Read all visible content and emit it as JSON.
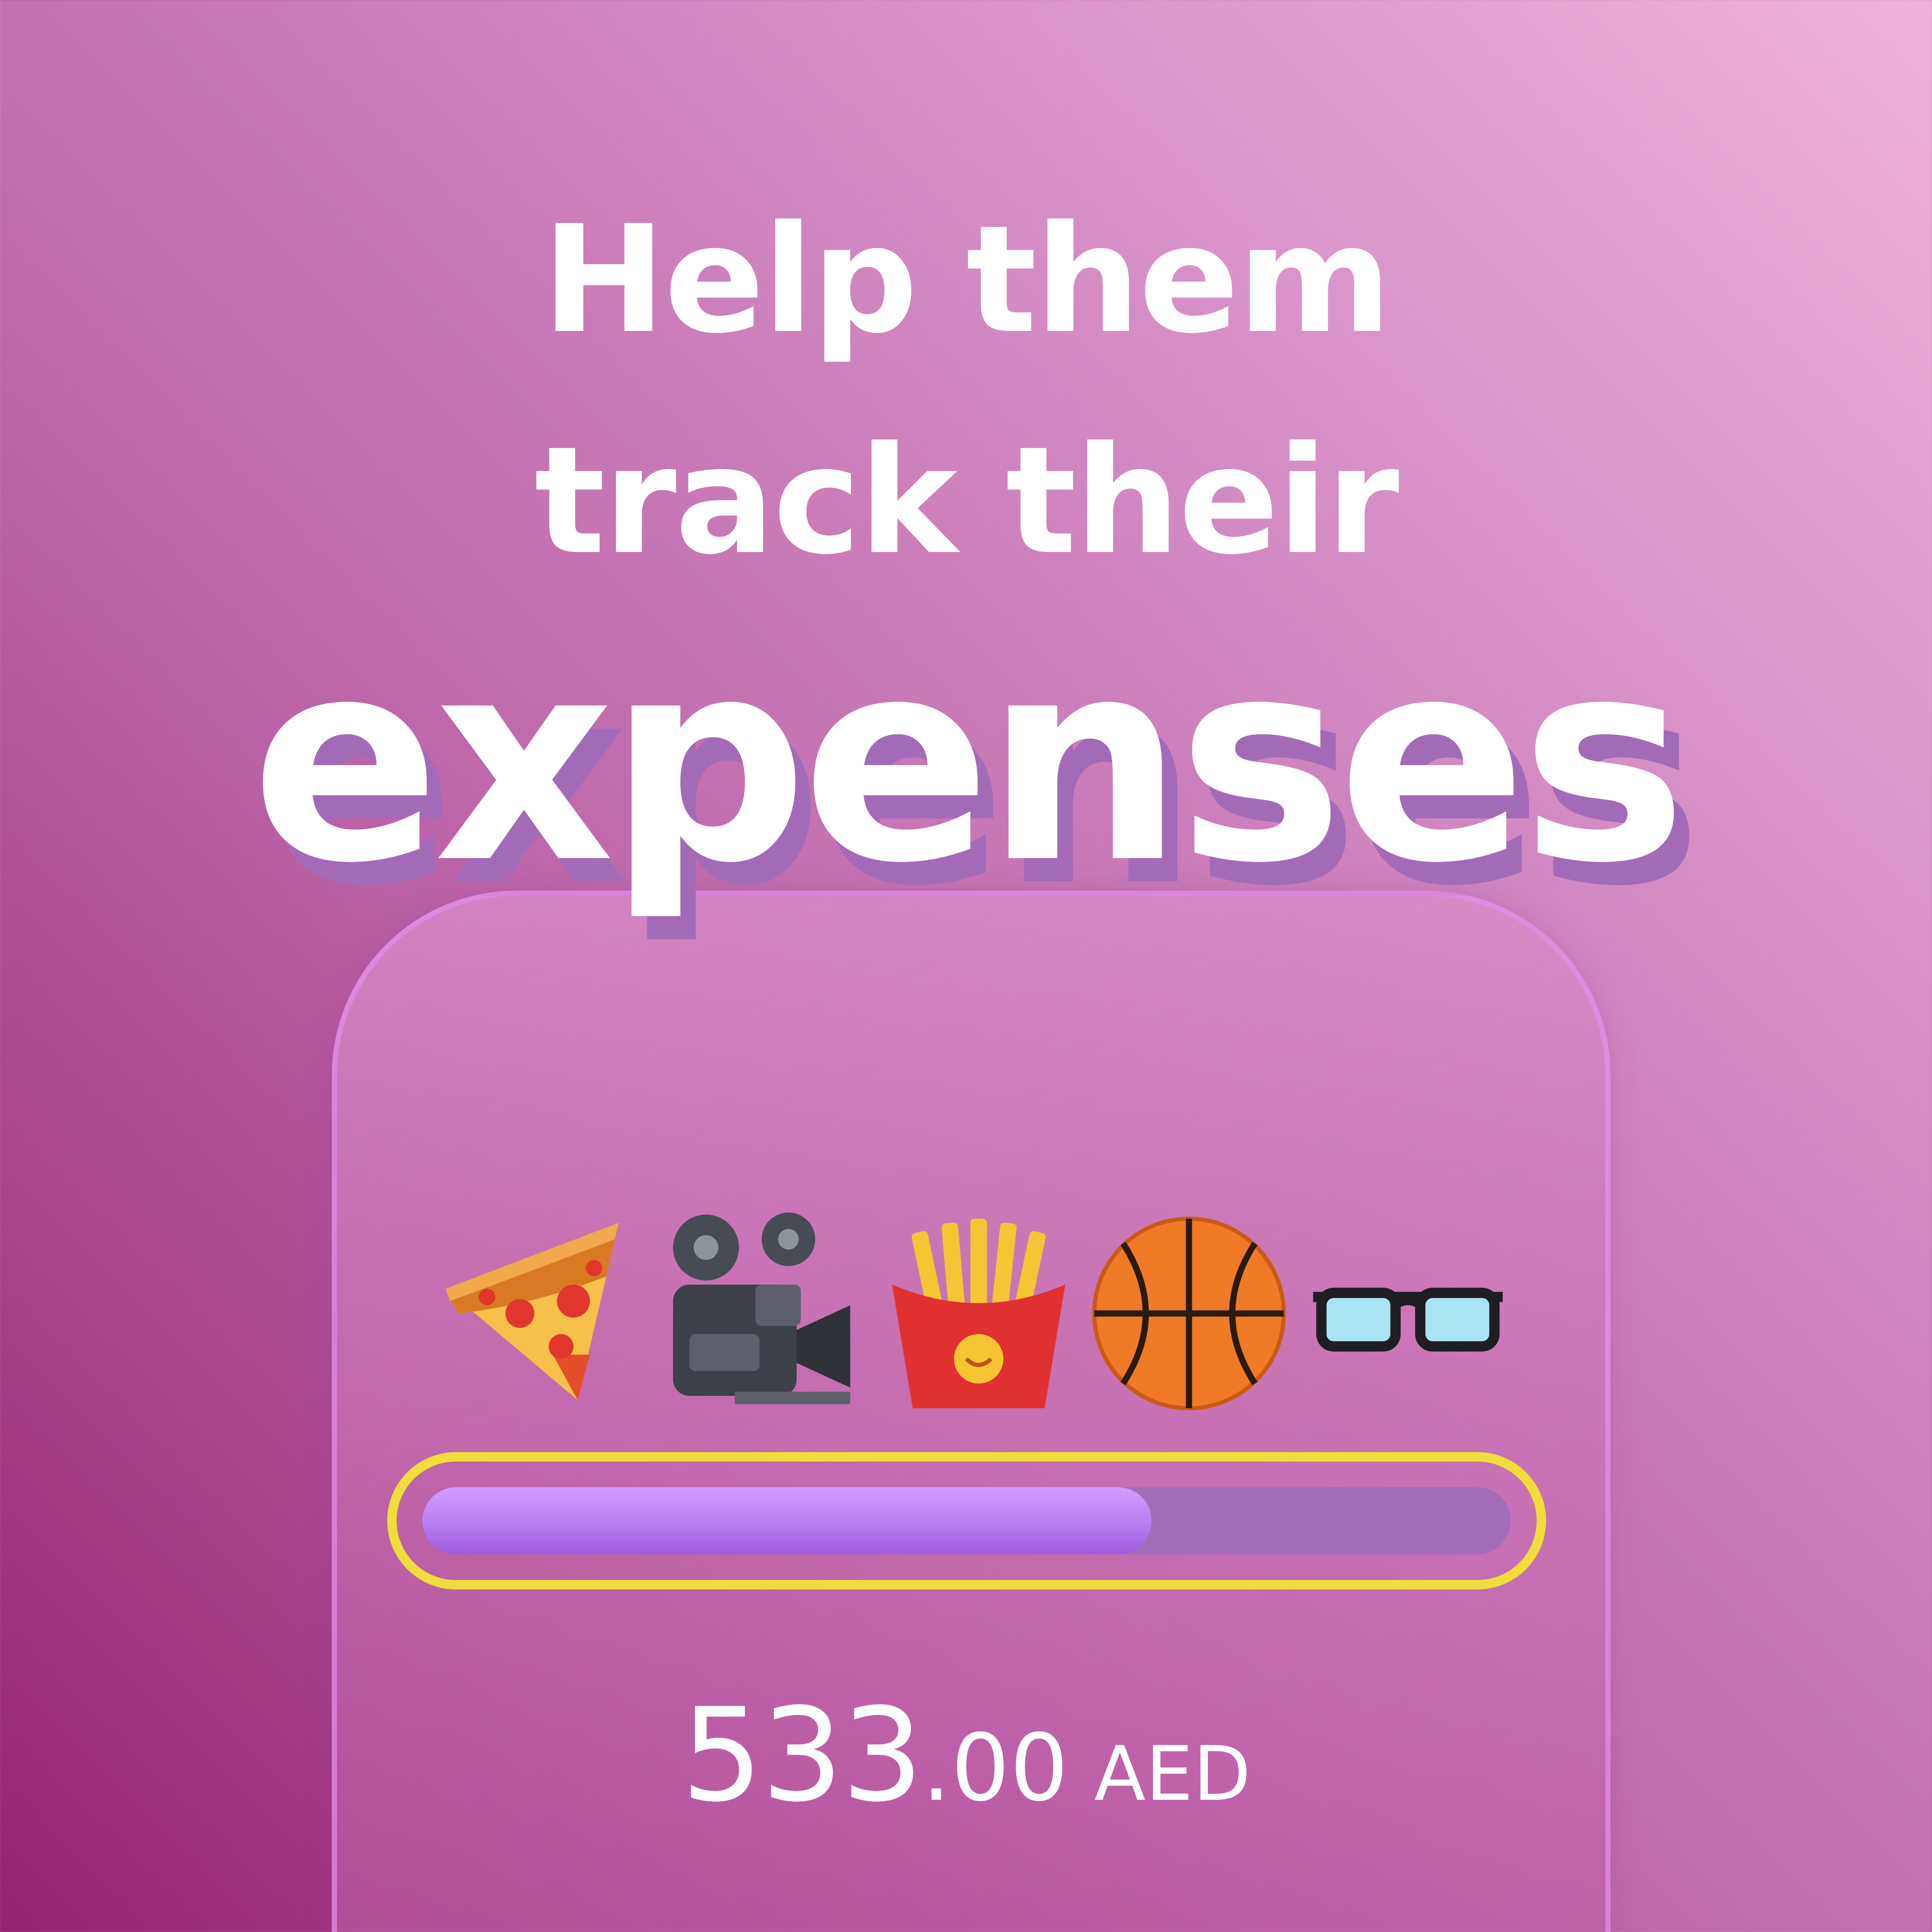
{
  "headline": {
    "line1": "Help them",
    "line2": "track their",
    "emphasis": "expenses"
  },
  "categories": [
    {
      "name": "pizza",
      "icon": "pizza-icon"
    },
    {
      "name": "movies",
      "icon": "movie-camera-icon"
    },
    {
      "name": "fries",
      "icon": "fries-icon"
    },
    {
      "name": "basketball",
      "icon": "basketball-icon"
    },
    {
      "name": "glasses",
      "icon": "glasses-icon"
    }
  ],
  "progress": {
    "fraction": 0.67,
    "border_color": "#f1dc3a",
    "fill_color": "#b97cef",
    "track_color": "#a46cb8"
  },
  "amount": {
    "integer": "533",
    "decimal": ".00",
    "currency": "AED"
  },
  "colors": {
    "background_light": "#f0b2da",
    "background_dark": "#952575",
    "text": "#ffffff",
    "hero_shadow": "#a36bb7"
  }
}
